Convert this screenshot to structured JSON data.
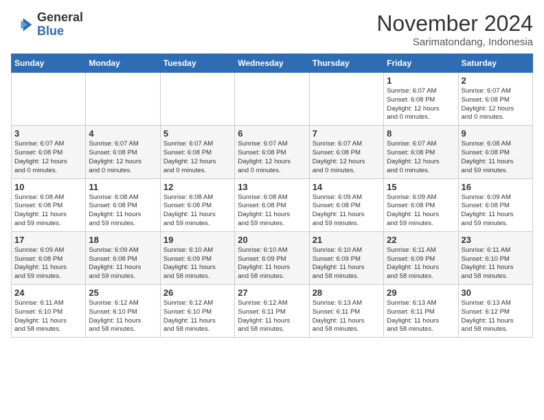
{
  "logo": {
    "general": "General",
    "blue": "Blue"
  },
  "title": "November 2024",
  "location": "Sarimatondang, Indonesia",
  "weekdays": [
    "Sunday",
    "Monday",
    "Tuesday",
    "Wednesday",
    "Thursday",
    "Friday",
    "Saturday"
  ],
  "weeks": [
    [
      {
        "day": "",
        "info": ""
      },
      {
        "day": "",
        "info": ""
      },
      {
        "day": "",
        "info": ""
      },
      {
        "day": "",
        "info": ""
      },
      {
        "day": "",
        "info": ""
      },
      {
        "day": "1",
        "info": "Sunrise: 6:07 AM\nSunset: 6:08 PM\nDaylight: 12 hours\nand 0 minutes."
      },
      {
        "day": "2",
        "info": "Sunrise: 6:07 AM\nSunset: 6:08 PM\nDaylight: 12 hours\nand 0 minutes."
      }
    ],
    [
      {
        "day": "3",
        "info": "Sunrise: 6:07 AM\nSunset: 6:08 PM\nDaylight: 12 hours\nand 0 minutes."
      },
      {
        "day": "4",
        "info": "Sunrise: 6:07 AM\nSunset: 6:08 PM\nDaylight: 12 hours\nand 0 minutes."
      },
      {
        "day": "5",
        "info": "Sunrise: 6:07 AM\nSunset: 6:08 PM\nDaylight: 12 hours\nand 0 minutes."
      },
      {
        "day": "6",
        "info": "Sunrise: 6:07 AM\nSunset: 6:08 PM\nDaylight: 12 hours\nand 0 minutes."
      },
      {
        "day": "7",
        "info": "Sunrise: 6:07 AM\nSunset: 6:08 PM\nDaylight: 12 hours\nand 0 minutes."
      },
      {
        "day": "8",
        "info": "Sunrise: 6:07 AM\nSunset: 6:08 PM\nDaylight: 12 hours\nand 0 minutes."
      },
      {
        "day": "9",
        "info": "Sunrise: 6:08 AM\nSunset: 6:08 PM\nDaylight: 11 hours\nand 59 minutes."
      }
    ],
    [
      {
        "day": "10",
        "info": "Sunrise: 6:08 AM\nSunset: 6:08 PM\nDaylight: 11 hours\nand 59 minutes."
      },
      {
        "day": "11",
        "info": "Sunrise: 6:08 AM\nSunset: 6:08 PM\nDaylight: 11 hours\nand 59 minutes."
      },
      {
        "day": "12",
        "info": "Sunrise: 6:08 AM\nSunset: 6:08 PM\nDaylight: 11 hours\nand 59 minutes."
      },
      {
        "day": "13",
        "info": "Sunrise: 6:08 AM\nSunset: 6:08 PM\nDaylight: 11 hours\nand 59 minutes."
      },
      {
        "day": "14",
        "info": "Sunrise: 6:09 AM\nSunset: 6:08 PM\nDaylight: 11 hours\nand 59 minutes."
      },
      {
        "day": "15",
        "info": "Sunrise: 6:09 AM\nSunset: 6:08 PM\nDaylight: 11 hours\nand 59 minutes."
      },
      {
        "day": "16",
        "info": "Sunrise: 6:09 AM\nSunset: 6:08 PM\nDaylight: 11 hours\nand 59 minutes."
      }
    ],
    [
      {
        "day": "17",
        "info": "Sunrise: 6:09 AM\nSunset: 6:08 PM\nDaylight: 11 hours\nand 59 minutes."
      },
      {
        "day": "18",
        "info": "Sunrise: 6:09 AM\nSunset: 6:08 PM\nDaylight: 11 hours\nand 59 minutes."
      },
      {
        "day": "19",
        "info": "Sunrise: 6:10 AM\nSunset: 6:09 PM\nDaylight: 11 hours\nand 58 minutes."
      },
      {
        "day": "20",
        "info": "Sunrise: 6:10 AM\nSunset: 6:09 PM\nDaylight: 11 hours\nand 58 minutes."
      },
      {
        "day": "21",
        "info": "Sunrise: 6:10 AM\nSunset: 6:09 PM\nDaylight: 11 hours\nand 58 minutes."
      },
      {
        "day": "22",
        "info": "Sunrise: 6:11 AM\nSunset: 6:09 PM\nDaylight: 11 hours\nand 58 minutes."
      },
      {
        "day": "23",
        "info": "Sunrise: 6:11 AM\nSunset: 6:10 PM\nDaylight: 11 hours\nand 58 minutes."
      }
    ],
    [
      {
        "day": "24",
        "info": "Sunrise: 6:11 AM\nSunset: 6:10 PM\nDaylight: 11 hours\nand 58 minutes."
      },
      {
        "day": "25",
        "info": "Sunrise: 6:12 AM\nSunset: 6:10 PM\nDaylight: 11 hours\nand 58 minutes."
      },
      {
        "day": "26",
        "info": "Sunrise: 6:12 AM\nSunset: 6:10 PM\nDaylight: 11 hours\nand 58 minutes."
      },
      {
        "day": "27",
        "info": "Sunrise: 6:12 AM\nSunset: 6:11 PM\nDaylight: 11 hours\nand 58 minutes."
      },
      {
        "day": "28",
        "info": "Sunrise: 6:13 AM\nSunset: 6:11 PM\nDaylight: 11 hours\nand 58 minutes."
      },
      {
        "day": "29",
        "info": "Sunrise: 6:13 AM\nSunset: 6:11 PM\nDaylight: 11 hours\nand 58 minutes."
      },
      {
        "day": "30",
        "info": "Sunrise: 6:13 AM\nSunset: 6:12 PM\nDaylight: 11 hours\nand 58 minutes."
      }
    ]
  ]
}
